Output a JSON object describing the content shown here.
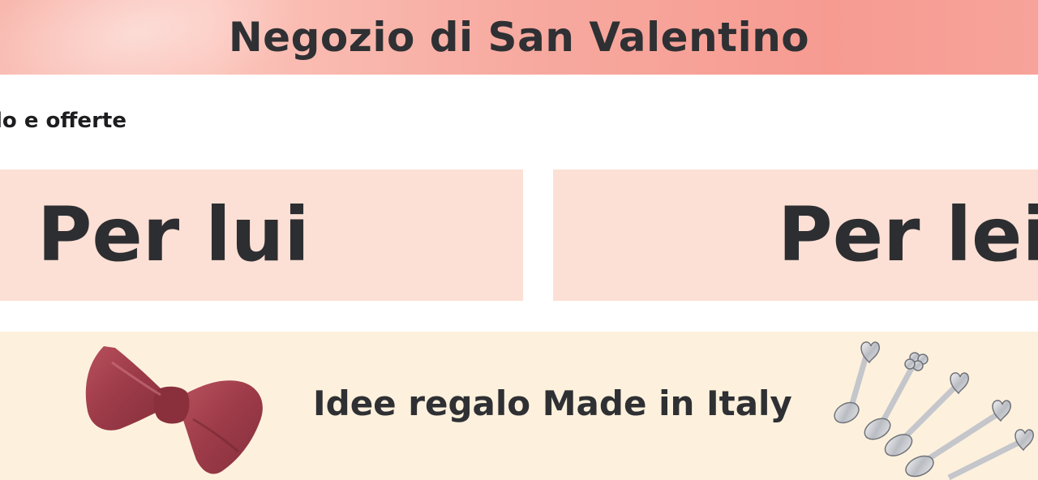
{
  "banner": {
    "title": "Negozio di San Valentino"
  },
  "section": {
    "subtitle": "lo e offerte"
  },
  "tiles": [
    {
      "label": "Per lui"
    },
    {
      "label": "Per lei"
    }
  ],
  "promo": {
    "label": "Idee regalo Made in Italy",
    "left_image": "red-bowtie",
    "right_image": "silver-heart-spoons"
  },
  "colors": {
    "banner_bg": "#f7a39a",
    "tile_bg": "#fde0d5",
    "promo_bg": "#fdf1dd",
    "text": "#2d2e31"
  }
}
